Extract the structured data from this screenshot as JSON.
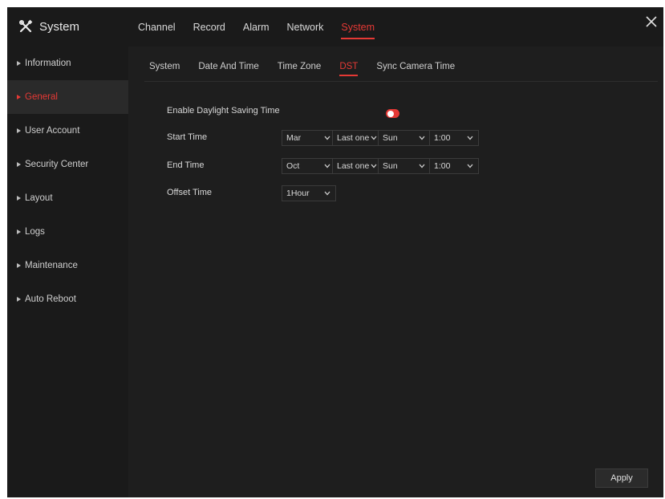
{
  "header": {
    "app_title": "System",
    "close_glyph": "X",
    "nav": [
      "Channel",
      "Record",
      "Alarm",
      "Network",
      "System"
    ],
    "active_nav": "System"
  },
  "sidebar": {
    "items": [
      {
        "label": "Information"
      },
      {
        "label": "General",
        "active": true
      },
      {
        "label": "User Account"
      },
      {
        "label": "Security Center"
      },
      {
        "label": "Layout"
      },
      {
        "label": "Logs"
      },
      {
        "label": "Maintenance"
      },
      {
        "label": "Auto Reboot"
      }
    ]
  },
  "tabs": {
    "items": [
      "System",
      "Date And Time",
      "Time Zone",
      "DST",
      "Sync Camera Time"
    ],
    "active": "DST"
  },
  "form": {
    "enable_label": "Enable Daylight Saving Time",
    "enable_on": true,
    "start_label": "Start Time",
    "start": {
      "month": "Mar",
      "week": "Last one",
      "day": "Sun",
      "time": "1:00"
    },
    "end_label": "End Time",
    "end": {
      "month": "Oct",
      "week": "Last one",
      "day": "Sun",
      "time": "1:00"
    },
    "offset_label": "Offset Time",
    "offset_value": "1Hour"
  },
  "actions": {
    "apply_label": "Apply"
  },
  "colors": {
    "accent": "#e53935",
    "background": "#1e1e1e",
    "panel": "#1a1a1a",
    "text": "#d8d8d8"
  },
  "icons": {
    "brand": "tools-icon",
    "close": "close-icon",
    "dropdown": "chevron-down-icon",
    "bullet": "triangle-right-icon"
  }
}
